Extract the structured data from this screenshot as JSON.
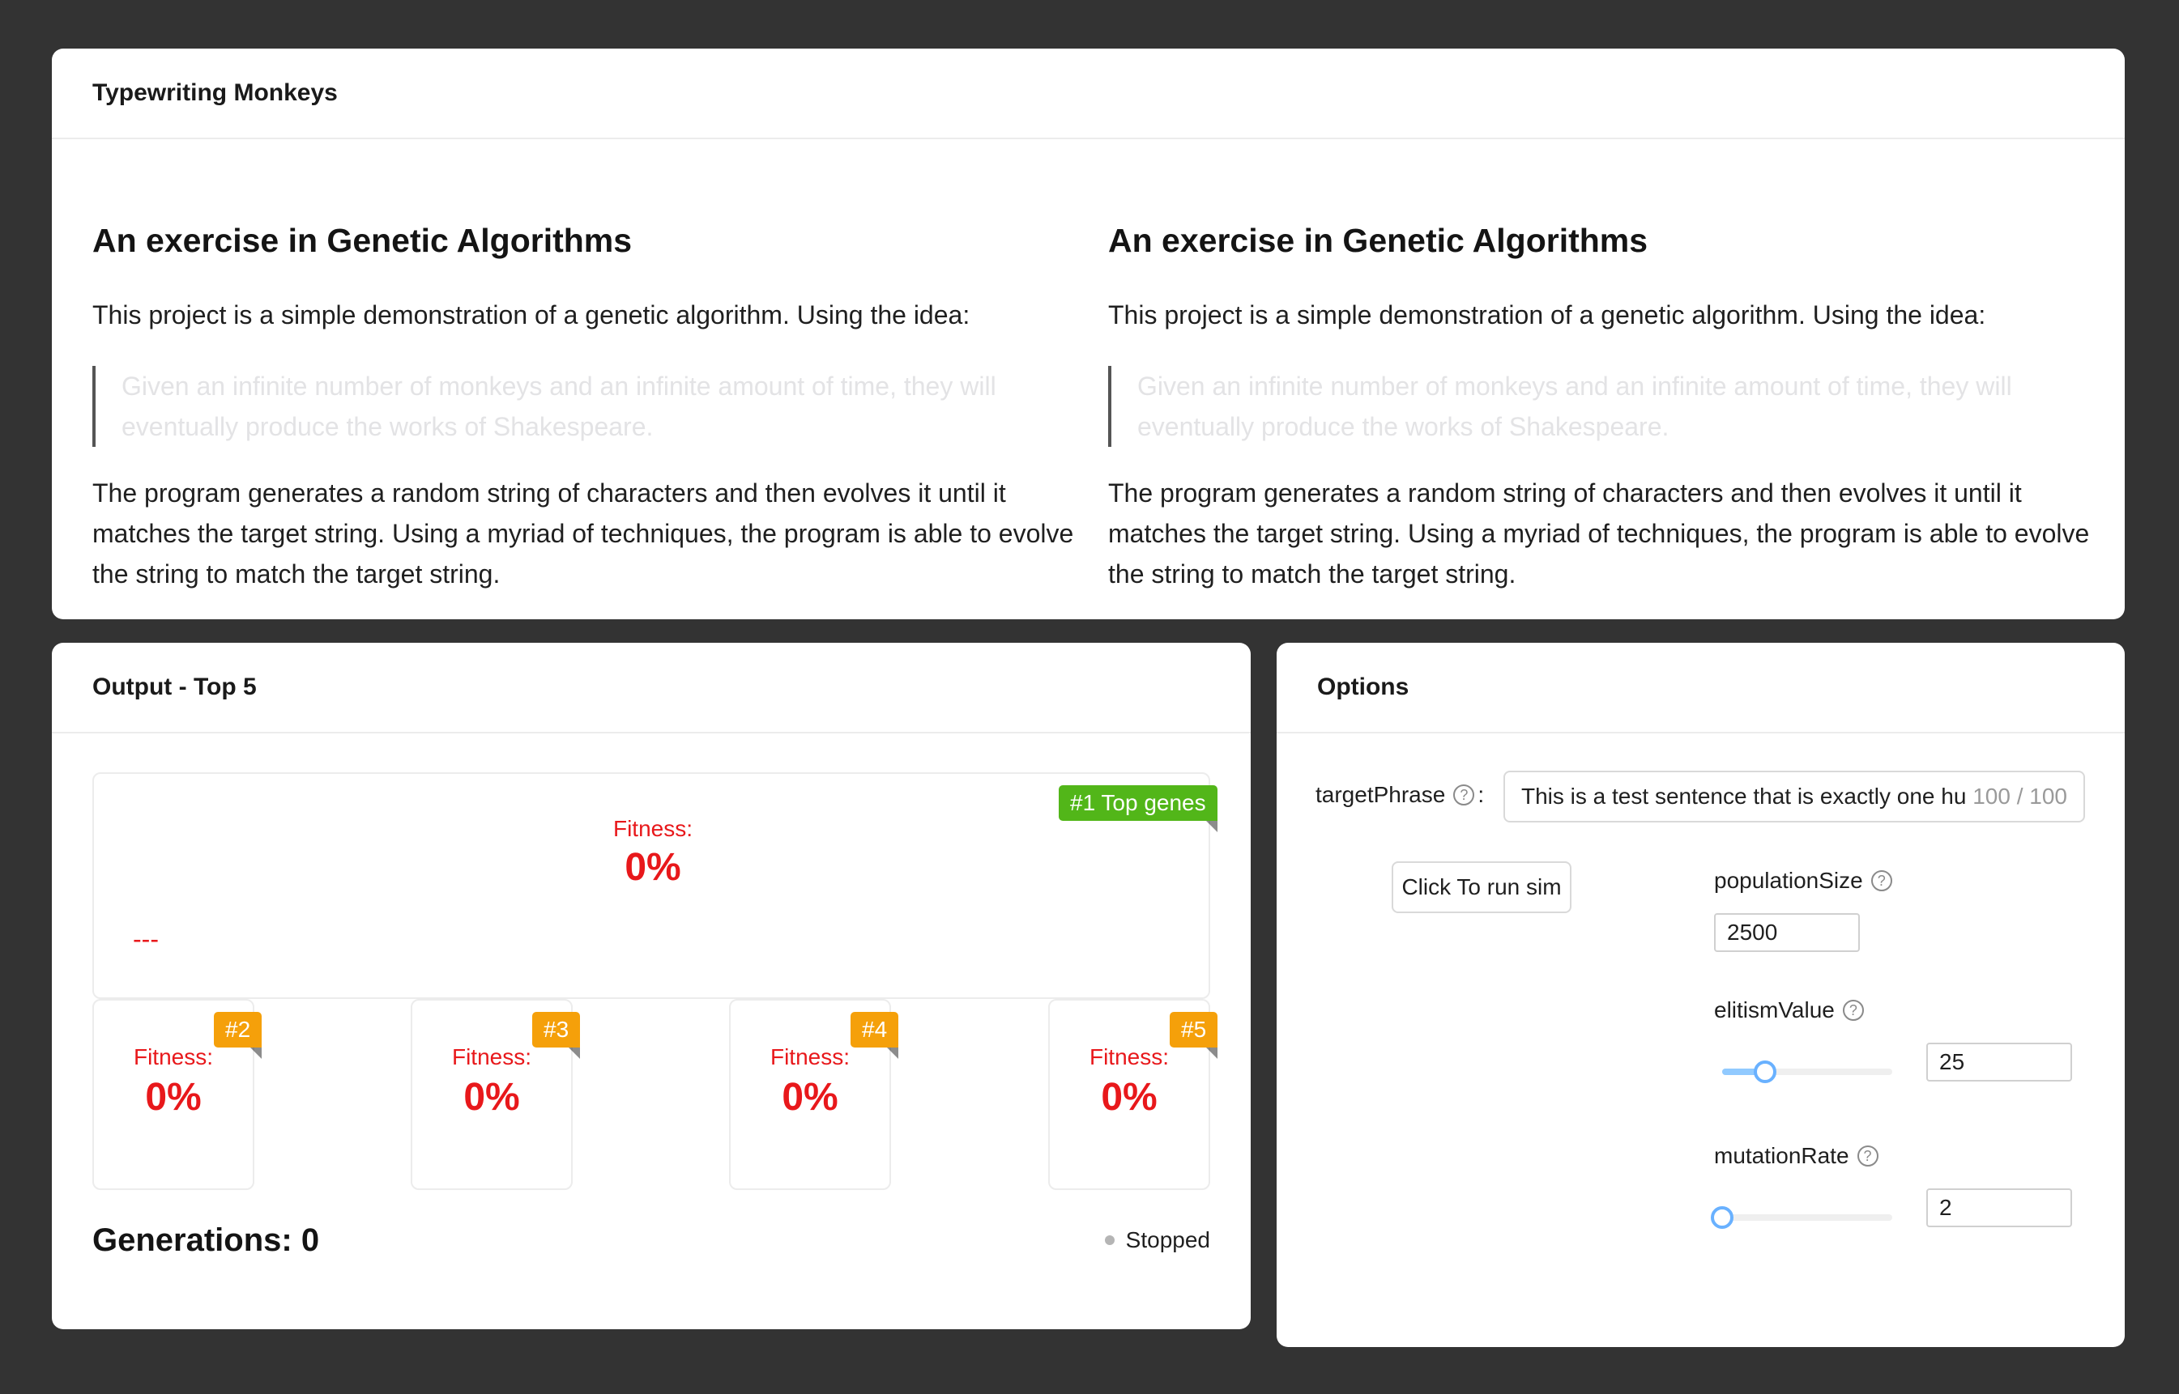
{
  "intro": {
    "title": "Typewriting Monkeys",
    "columns": [
      {
        "heading": "An exercise in Genetic Algorithms",
        "intro": "This project is a simple demonstration of a genetic algorithm. Using the idea:",
        "quote": "Given an infinite number of monkeys and an infinite amount of time, they will eventually produce the works of Shakespeare.",
        "body": "The program generates a random string of characters and then evolves it until it matches the target string. Using a myriad of techniques, the program is able to evolve the string to match the target string."
      },
      {
        "heading": "An exercise in Genetic Algorithms",
        "intro": "This project is a simple demonstration of a genetic algorithm. Using the idea:",
        "quote": "Given an infinite number of monkeys and an infinite amount of time, they will eventually produce the works of Shakespeare.",
        "body": "The program generates a random string of characters and then evolves it until it matches the target string. Using a myriad of techniques, the program is able to evolve the string to match the target string."
      }
    ]
  },
  "output": {
    "title": "Output - Top 5",
    "top": {
      "rank": "#1 Top genes",
      "fitness_label": "Fitness:",
      "fitness_value": "0%",
      "genes": "---"
    },
    "others": [
      {
        "rank": "#2",
        "fitness_label": "Fitness:",
        "fitness_value": "0%"
      },
      {
        "rank": "#3",
        "fitness_label": "Fitness:",
        "fitness_value": "0%"
      },
      {
        "rank": "#4",
        "fitness_label": "Fitness:",
        "fitness_value": "0%"
      },
      {
        "rank": "#5",
        "fitness_label": "Fitness:",
        "fitness_value": "0%"
      }
    ],
    "generations": "Generations: 0",
    "status": "Stopped"
  },
  "options": {
    "title": "Options",
    "target_phrase": {
      "label": "targetPhrase",
      "colon": ":",
      "value": "This is a test sentence that is exactly one hundred characters long, for testing the algorithm ok",
      "count": "100 / 100"
    },
    "run_button": "Click To run sim",
    "population_size": {
      "label": "populationSize",
      "value": "2500"
    },
    "elitism_value": {
      "label": "elitismValue",
      "value": "25",
      "slider_fraction": 0.25
    },
    "mutation_rate": {
      "label": "mutationRate",
      "value": "2",
      "slider_fraction": 0.0
    },
    "help_icon": "question-circle-icon"
  },
  "colors": {
    "background": "#333333",
    "fitness_red": "#e8181b",
    "top_ribbon_green": "#52b619",
    "rank_ribbon_orange": "#f5a00a",
    "slider_blue": "#69b1ff"
  }
}
